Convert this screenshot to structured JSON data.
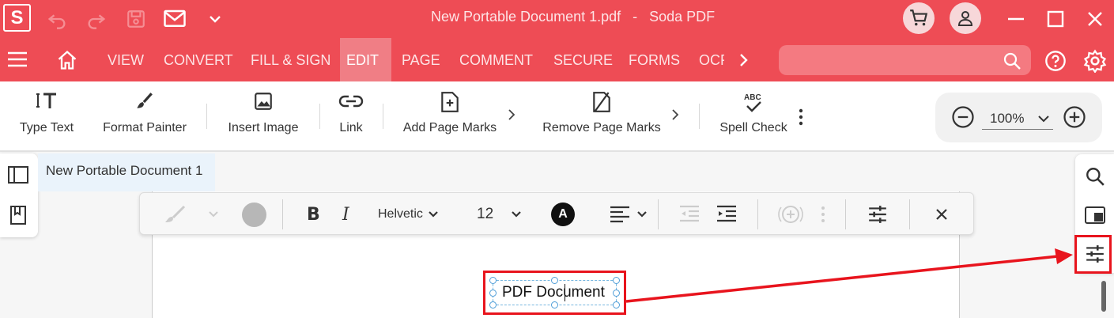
{
  "window": {
    "logo": "S",
    "title": "New Portable Document 1.pdf   -   Soda PDF"
  },
  "menu": {
    "tabs": [
      "VIEW",
      "CONVERT",
      "FILL & SIGN",
      "EDIT",
      "PAGE",
      "COMMENT",
      "SECURE",
      "FORMS",
      "OCR"
    ],
    "active_tab": "EDIT",
    "search_placeholder": ""
  },
  "toolbar": {
    "tools": [
      "Type Text",
      "Format Painter",
      "Insert Image",
      "Link",
      "Add Page Marks",
      "Remove Page Marks",
      "Spell Check"
    ],
    "zoom": "100%"
  },
  "document": {
    "tab_title": "New Portable Document 1",
    "textbox_text": "PDF Document"
  },
  "format_bar": {
    "font": "Helvetic",
    "size": "12",
    "font_color_letter": "A"
  },
  "colors": {
    "brand": "#ee4c55",
    "active_tab": "#f07e85",
    "annotation": "#e8141d"
  }
}
